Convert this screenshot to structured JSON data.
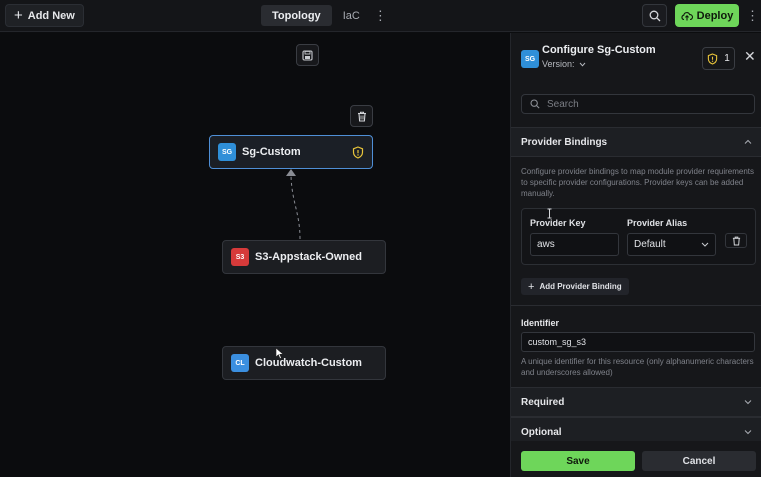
{
  "topbar": {
    "add_new_label": "Add New",
    "tabs": [
      {
        "label": "Topology",
        "active": true
      },
      {
        "label": "IaC",
        "active": false
      }
    ],
    "deploy_label": "Deploy"
  },
  "canvas": {
    "nodes": [
      {
        "badge": "SG",
        "label": "Sg-Custom",
        "selected": true,
        "icon": "shield-warning-icon"
      },
      {
        "badge": "S3",
        "label": "S3-Appstack-Owned",
        "selected": false
      },
      {
        "badge": "CL",
        "label": "Cloudwatch-Custom",
        "selected": false
      }
    ]
  },
  "panel": {
    "badge": "SG",
    "title": "Configure Sg-Custom",
    "version_label": "Version:",
    "warning_count": "1",
    "search_placeholder": "Search",
    "provider_bindings": {
      "title": "Provider Bindings",
      "description": "Configure provider bindings to map module provider requirements to specific provider configurations. Provider keys can be added manually.",
      "key_label": "Provider Key",
      "alias_label": "Provider Alias",
      "key_value": "aws",
      "alias_value": "Default",
      "add_label": "Add Provider Binding"
    },
    "identifier": {
      "label": "Identifier",
      "value": "custom_sg_s3",
      "help": "A unique identifier for this resource (only alphanumeric characters and underscores allowed)"
    },
    "required_label": "Required",
    "optional_label": "Optional",
    "save_label": "Save",
    "cancel_label": "Cancel"
  },
  "colors": {
    "accent_green": "#6ed65a",
    "selected_border": "#4f8fd6",
    "warning_yellow": "#e8c43a",
    "s3_red": "#d63a3a",
    "sg_blue": "#2f8fd8"
  }
}
